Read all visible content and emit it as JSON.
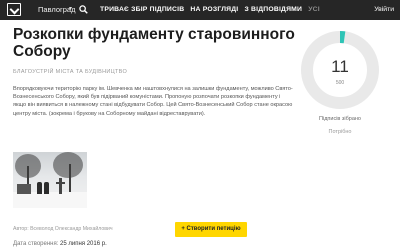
{
  "header": {
    "city": "Павлоград",
    "nav": [
      "ТРИВАЄ ЗБІР ПІДПИСІВ",
      "НА РОЗГЛЯДІ",
      "З ВІДПОВІДЯМИ",
      "УСІ"
    ],
    "login": "Увійти"
  },
  "petition": {
    "title": "Розкопки фундаменту старовинного Собору",
    "category": "Благоустрій міста та будівництво",
    "description": "Впорядковуючи територію парку ім. Шевченка ми наштовхнулися на залишки фундаменту, можливо Свято-Вознесенського Собору, який був підірваний комуністами. Пропоную розпочати розкопки фундаменту і якщо він виявиться в належному стані відбудувати Собор. Цей Свято-Вознесенський Собор стане окрасою центру міста. (зокрема і брукову на Соборному майдані відреставрувати).",
    "photo_author": "Автор: Всеволод Олександр Михайлович",
    "date_label": "Дата створення:",
    "date_value": "25 липня 2016 р."
  },
  "actions": {
    "create_petition": "+ Створити петицію"
  },
  "progress": {
    "count": "11",
    "goal": "500",
    "collected_label": "Підписів зібрано",
    "needed_label": "Потрібно",
    "fraction": 0.022,
    "accent_color": "#2ec4b6",
    "track_color": "#e9e9e9"
  }
}
